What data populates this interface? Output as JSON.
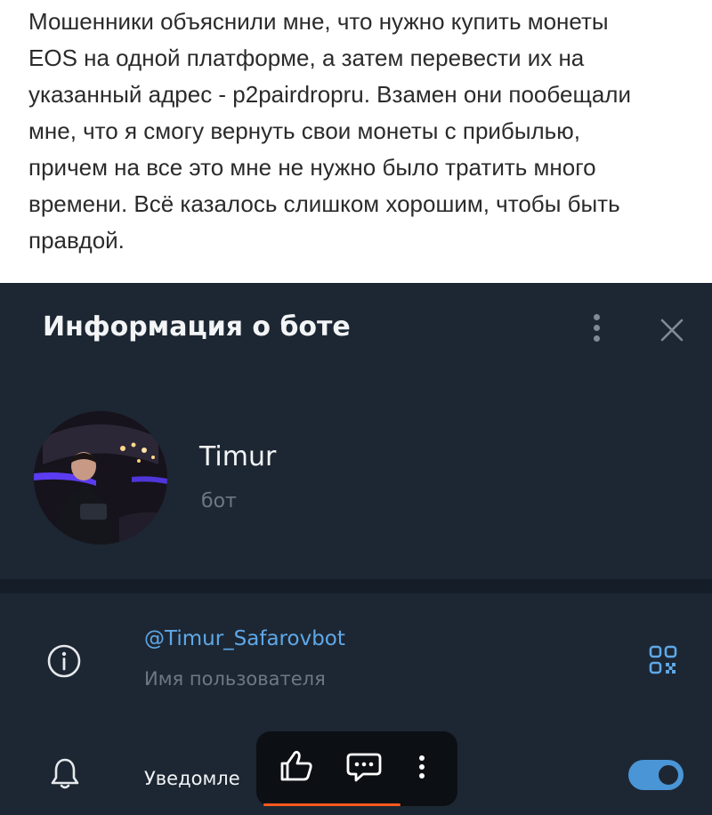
{
  "article": {
    "lines": [
      "Мошенники объяснили мне, что нужно купить монеты",
      "EOS на одной платформе, а затем перевести их на",
      "указанный адрес - p2pairdropru. Взамен они пообещали",
      "мне, что я смогу вернуть свои монеты с прибылью,",
      "причем на все это мне не нужно было тратить много",
      "времени. Всё казалось слишком хорошим, чтобы быть",
      "правдой."
    ]
  },
  "bot_info": {
    "title": "Информация о боте",
    "name": "Timur",
    "role": "бот",
    "username": "@Timur_Safarovbot",
    "username_label": "Имя пользователя",
    "notifications_label": "Уведомле",
    "notifications_on": true
  },
  "reaction_bar": {
    "icons": [
      "thumbs-up-icon",
      "comment-icon",
      "more-vertical-icon"
    ]
  },
  "colors": {
    "panel_bg": "#1d2733",
    "link": "#5fa8e8",
    "toggle": "#4a95d6",
    "accent_underline": "#ff5a1f"
  }
}
